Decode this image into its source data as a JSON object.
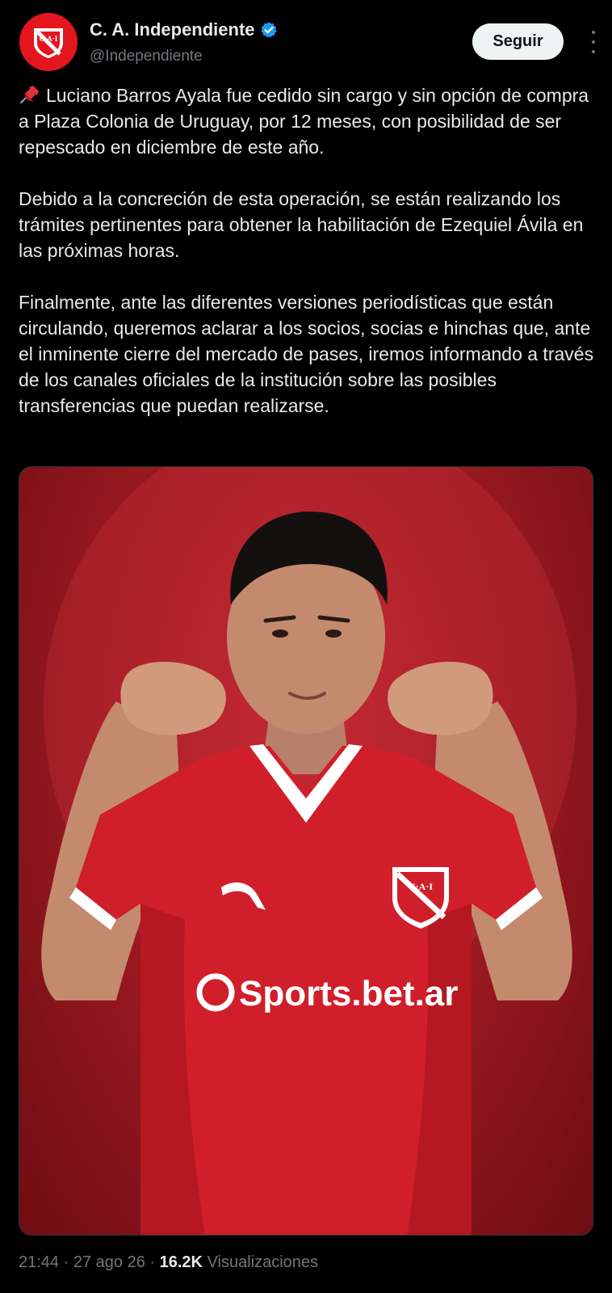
{
  "account": {
    "display_name": "C. A. Independiente",
    "handle": "@Independiente",
    "verified": true,
    "avatar_text": "C·A·I",
    "avatar_color": "#e3161f"
  },
  "follow_button": {
    "label": "Seguir"
  },
  "tweet": {
    "paragraphs": [
      "Luciano Barros Ayala fue cedido sin cargo y sin opción de compra a Plaza Colonia de Uruguay, por 12 meses, con posibilidad de ser repescado en diciembre de este año.",
      "Debido a la concreción de esta operación, se están realizando los trámites pertinentes para obtener la habilitación de Ezequiel Ávila en las próximas horas.",
      "Finalmente, ante las diferentes versiones periodísticas que están circulando, queremos aclarar a los socios, socias e hinchas que, ante el inminente cierre del mercado de pases, iremos informando a través de los canales oficiales de la institución sobre las posibles transferencias que puedan realizarse."
    ],
    "lead_icon": "pushpin-icon"
  },
  "photo": {
    "sponsor_text": "Sports.bet.ar",
    "crest_text": "C·A·I",
    "background_color": "#b01e26"
  },
  "meta": {
    "time": "21:44",
    "date": "27 ago 26",
    "views_count": "16.2K",
    "views_label": "Visualizaciones"
  }
}
